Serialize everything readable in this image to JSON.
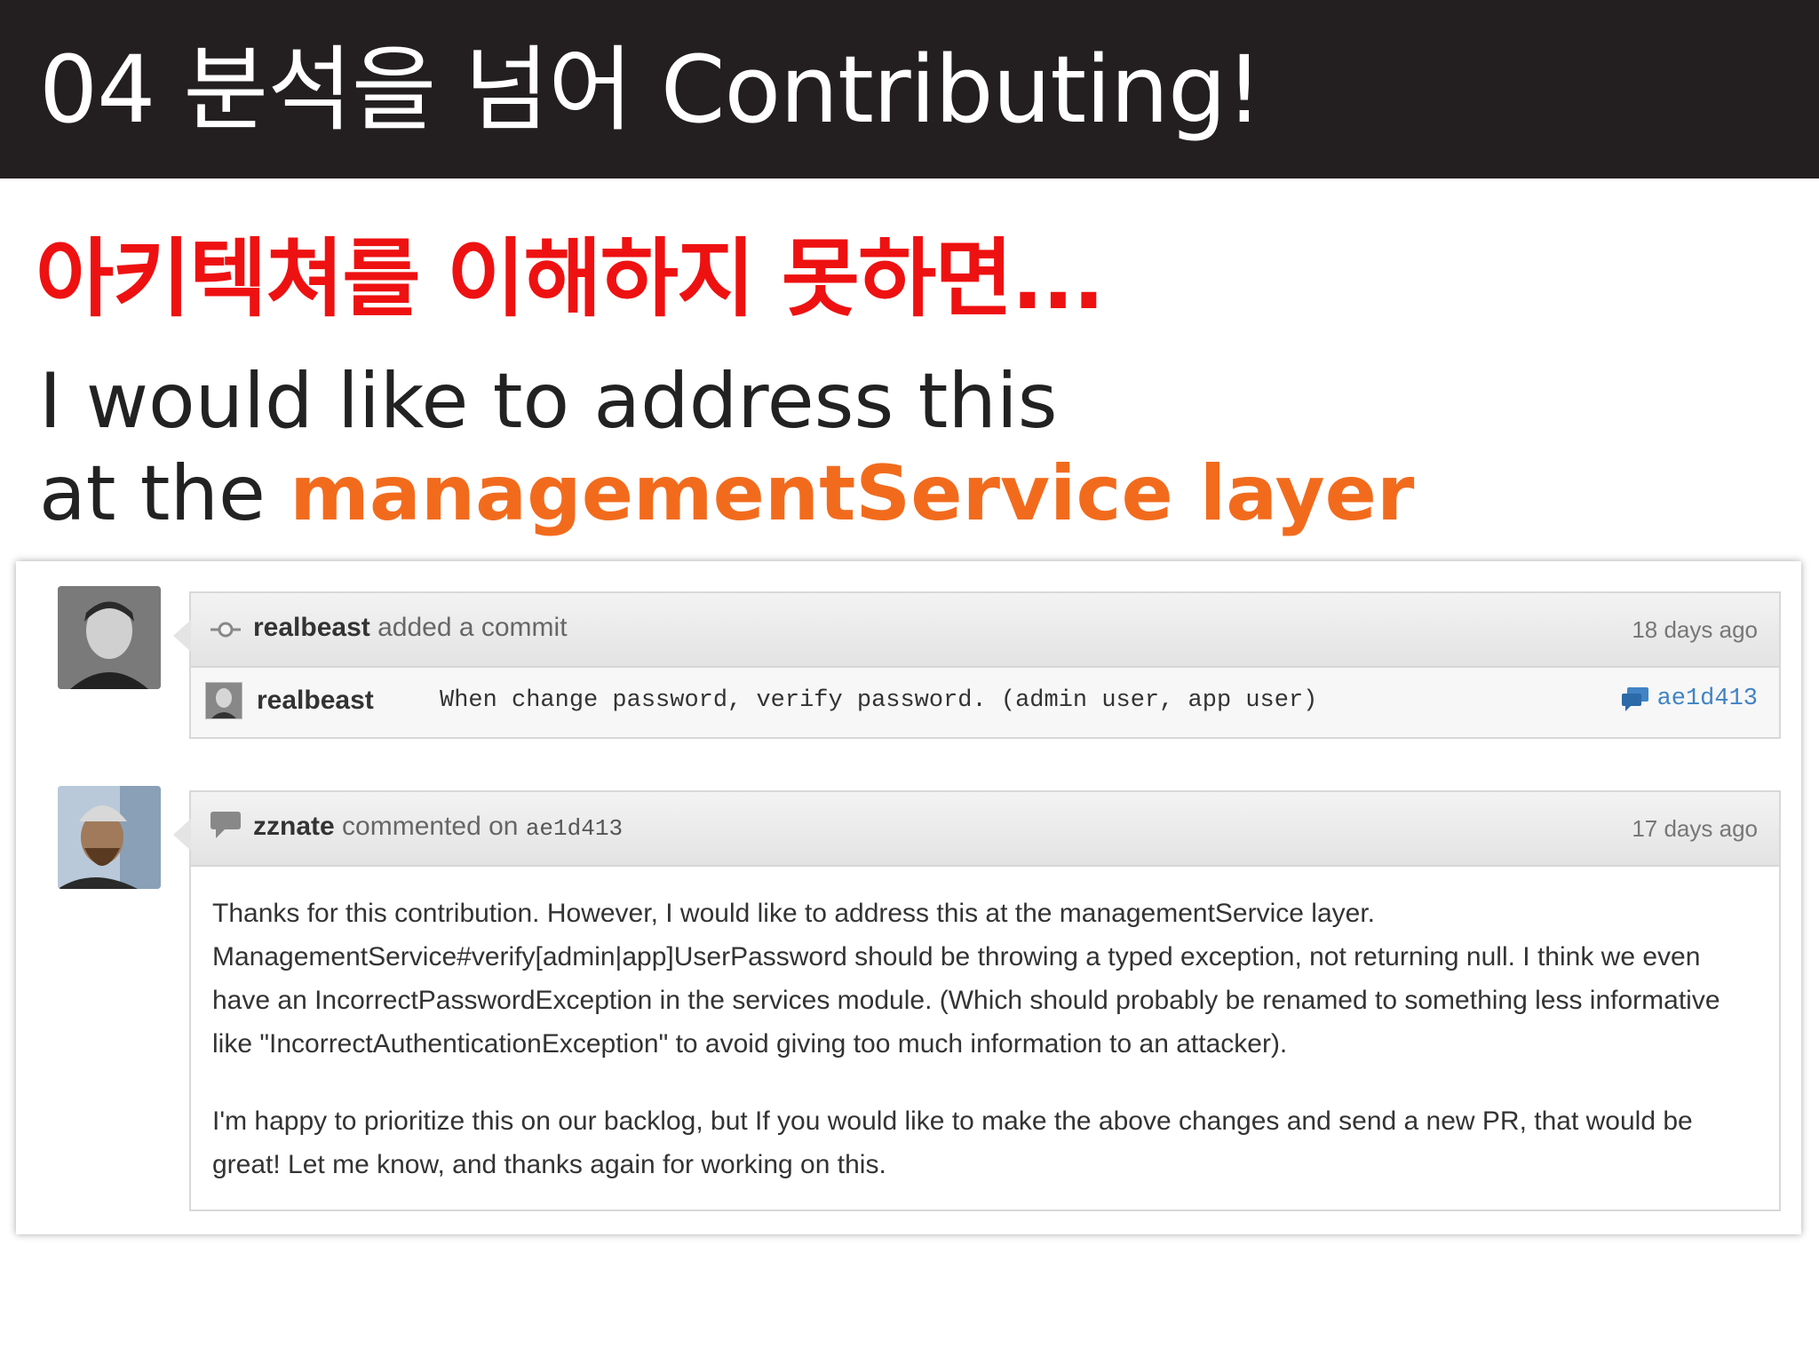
{
  "slide": {
    "title": "04 분석을 넘어 Contributing!",
    "headline": "아키텍쳐를 이해하지 못하면...",
    "quote_line1": "I would like to address this",
    "quote_line2_prefix": "at the ",
    "quote_line2_highlight": "managementService layer"
  },
  "colors": {
    "title_bar": "#231f20",
    "headline": "#ee1111",
    "highlight": "#f26b1d",
    "link": "#4183c4"
  },
  "commit_event": {
    "icon": "commit-icon",
    "user": "realbeast",
    "action": "added a commit",
    "time": "18 days ago",
    "commit": {
      "author": "realbeast",
      "message": "When change password, verify password. (admin user, app user)",
      "comment_icon": "comment-bubble-icon",
      "sha": "ae1d413"
    }
  },
  "comment_event": {
    "icon": "comment-icon",
    "user": "zznate",
    "action": "commented on",
    "target": "ae1d413",
    "time": "17 days ago",
    "paragraphs": [
      "Thanks for this contribution. However, I would like to address this at the managementService layer. ManagementService#verify[admin|app]UserPassword should be throwing a typed exception, not returning null. I think we even have an IncorrectPasswordException in the services module. (Which should probably be renamed to something less informative like \"IncorrectAuthenticationException\" to avoid giving too much information to an attacker).",
      "I'm happy to prioritize this on our backlog, but If you would like to make the above changes and send a new PR, that would be great! Let me know, and thanks again for working on this."
    ]
  }
}
